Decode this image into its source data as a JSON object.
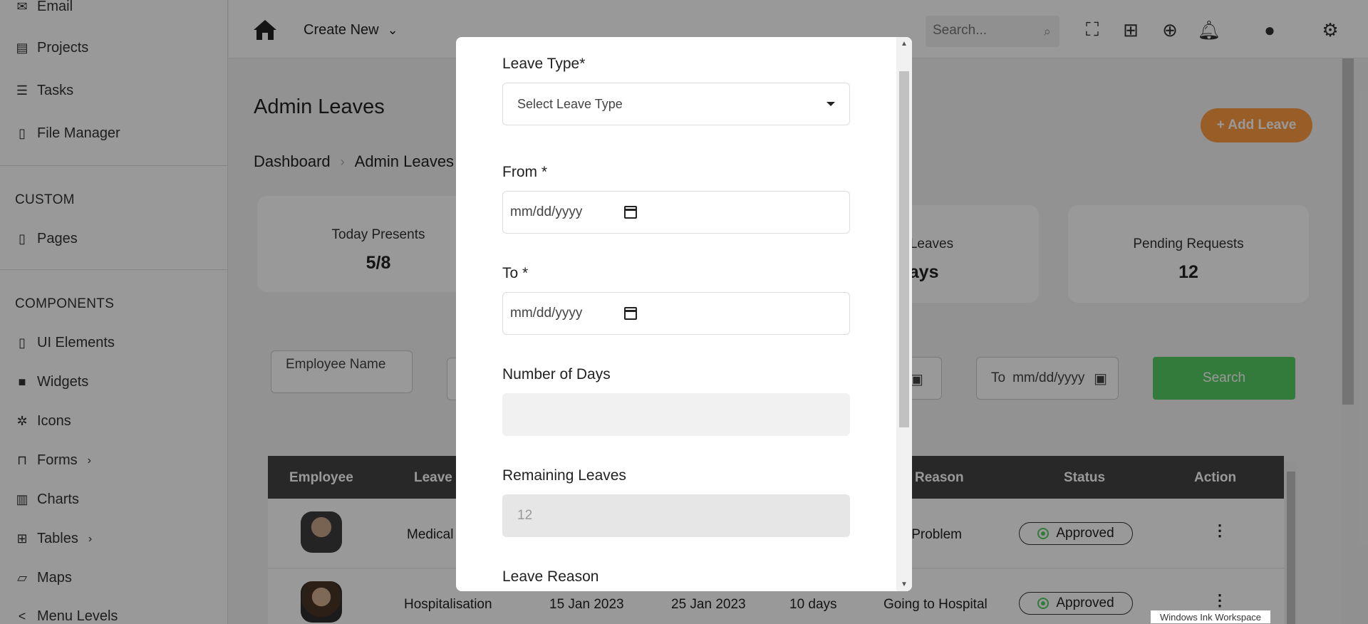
{
  "sidebar": {
    "items_top": [
      {
        "label": "Email",
        "icon": "mail-icon"
      },
      {
        "label": "Projects",
        "icon": "projects-icon"
      },
      {
        "label": "Tasks",
        "icon": "tasks-icon"
      },
      {
        "label": "File Manager",
        "icon": "file-icon"
      }
    ],
    "custom_heading": "CUSTOM",
    "custom_items": [
      {
        "label": "Pages",
        "icon": "page-icon"
      }
    ],
    "components_heading": "COMPONENTS",
    "component_items": [
      {
        "label": "UI Elements",
        "icon": "ui-icon"
      },
      {
        "label": "Widgets",
        "icon": "gift-icon"
      },
      {
        "label": "Icons",
        "icon": "bug-icon"
      },
      {
        "label": "Forms",
        "icon": "bookmark-icon"
      },
      {
        "label": "Charts",
        "icon": "bar-chart-icon"
      },
      {
        "label": "Tables",
        "icon": "grid-icon"
      },
      {
        "label": "Maps",
        "icon": "map-icon"
      },
      {
        "label": "Menu Levels",
        "icon": "share-icon"
      }
    ]
  },
  "topbar": {
    "create_new": "Create New",
    "search_placeholder": "Search..."
  },
  "page": {
    "title": "Admin Leaves",
    "breadcrumb": [
      "Dashboard",
      "Admin Leaves"
    ],
    "add_leave": "+ Add Leave"
  },
  "stats": [
    {
      "label": "Today Presents",
      "value": "5/8"
    },
    {
      "label": "ned Leaves",
      "value": "days"
    },
    {
      "label": "Pending Requests",
      "value": "12"
    }
  ],
  "filters": {
    "employee_name": "Employee Name",
    "to_label": "To",
    "to_date": "mm/dd/yyyy",
    "search": "Search"
  },
  "table": {
    "headers": [
      "Employee",
      "Leave",
      "Reason",
      "Status",
      "Action"
    ],
    "rows": [
      {
        "leave": "Medical",
        "from": "",
        "to": "",
        "days": "",
        "reason": "ily Problem",
        "status": "Approved"
      },
      {
        "leave": "Hospitalisation",
        "from": "15 Jan 2023",
        "to": "25 Jan 2023",
        "days": "10 days",
        "reason": "Going to Hospital",
        "status": "Approved"
      }
    ]
  },
  "modal": {
    "leave_type_label": "Leave Type*",
    "leave_type_value": "Select Leave Type",
    "from_label": "From *",
    "from_value": "mm/dd/yyyy",
    "to_label": "To *",
    "to_value": "mm/dd/yyyy",
    "days_label": "Number of Days",
    "days_value": "",
    "remaining_label": "Remaining Leaves",
    "remaining_value": "12",
    "reason_label": "Leave Reason"
  },
  "tooltip": "Windows Ink Workspace",
  "colors": {
    "accent": "#ff9b44",
    "success": "#55ce63",
    "table_header": "#444444"
  }
}
